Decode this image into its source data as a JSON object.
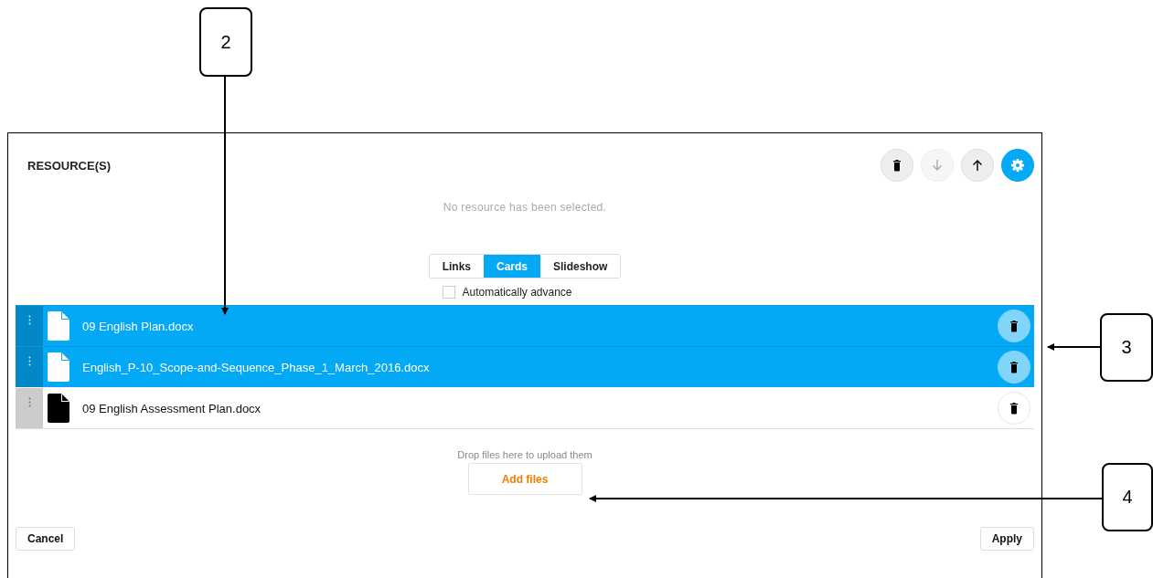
{
  "dialog": {
    "title": "RESOURCE(S)",
    "toolbar": [
      {
        "kind": "delete",
        "disabled": false
      },
      {
        "kind": "down",
        "disabled": true
      },
      {
        "kind": "up",
        "disabled": false
      },
      {
        "kind": "settings",
        "disabled": false
      }
    ],
    "message": "No resource has been selected.",
    "view_tabs": [
      {
        "label": "Links",
        "selected": false
      },
      {
        "label": "Cards",
        "selected": true
      },
      {
        "label": "Slideshow",
        "selected": false
      }
    ],
    "auto_advance": {
      "label": "Automatically advance",
      "checked": false
    },
    "files": [
      {
        "name": "09 English Plan.docx",
        "selected": true
      },
      {
        "name": "English_P-10_Scope-and-Sequence_Phase_1_March_2016.docx",
        "selected": true
      },
      {
        "name": "09 English Assessment Plan.docx",
        "selected": false
      }
    ],
    "drop_hint": "Drop files here to upload them",
    "add_button": "Add files",
    "cancel_button": "Cancel",
    "apply_button": "Apply"
  },
  "callouts": [
    {
      "label": "2"
    },
    {
      "label": "3"
    },
    {
      "label": "4"
    }
  ]
}
